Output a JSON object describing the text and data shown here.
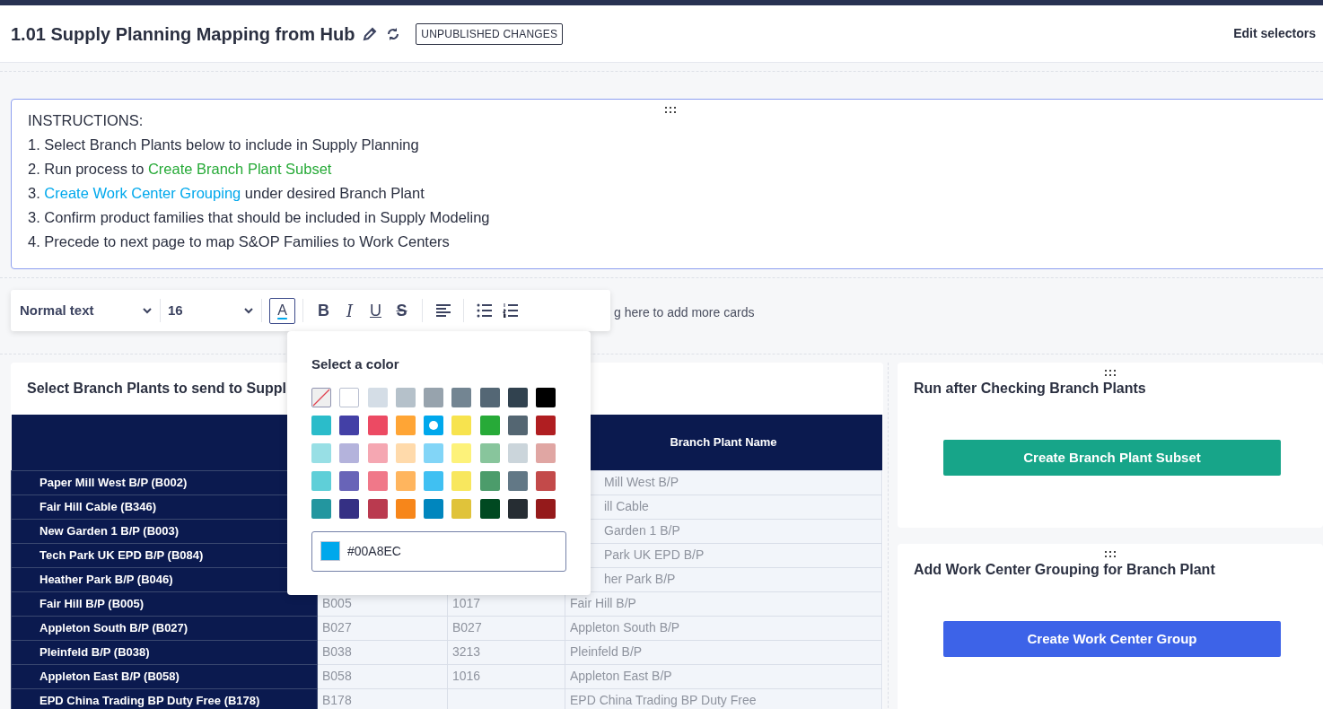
{
  "header": {
    "title": "1.01 Supply Planning Mapping from Hub",
    "badge": "UNPUBLISHED CHANGES",
    "action": "Edit selectors"
  },
  "instructions": {
    "lines": [
      [
        {
          "text": "INSTRUCTIONS:"
        }
      ],
      [
        {
          "text": "1. Select Branch Plants below to include in Supply Planning"
        }
      ],
      [
        {
          "text": "2. Run process to "
        },
        {
          "text": "Create Branch Plant Subset",
          "color": "#27aa38"
        }
      ],
      [
        {
          "text": "3. "
        },
        {
          "text": "Create Work Center Grouping",
          "color": "#00a8ec"
        },
        {
          "text": " under desired Branch Plant"
        }
      ],
      [
        {
          "text": "3. Confirm product families that should be included in Supply Modeling"
        }
      ],
      [
        {
          "text": "4. Precede to next page to map S&OP Families to Work Centers"
        }
      ]
    ]
  },
  "toolbar": {
    "style": "Normal text",
    "size": "16",
    "tools": [
      {
        "kind": "color",
        "label": "A",
        "selected": true
      },
      {
        "kind": "bold",
        "label": "B",
        "selected": false
      },
      {
        "kind": "italic",
        "label": "I",
        "selected": false
      },
      {
        "kind": "underline",
        "label": "U",
        "selected": false
      },
      {
        "kind": "strike",
        "label": "S",
        "selected": false
      },
      {
        "kind": "align",
        "selected": false
      },
      {
        "kind": "bullets",
        "selected": false
      },
      {
        "kind": "numbered",
        "selected": false
      }
    ]
  },
  "drop_hint": "g here to add more cards",
  "color_picker": {
    "title": "Select a color",
    "hex": "#00A8EC",
    "swatches": [
      {
        "kind": "none",
        "selected": false
      },
      {
        "color": "#ffffff",
        "selected": false
      },
      {
        "color": "#d4dde6",
        "selected": false
      },
      {
        "color": "#b5c1ca",
        "selected": false
      },
      {
        "color": "#97a3ad",
        "selected": false
      },
      {
        "color": "#738592",
        "selected": false
      },
      {
        "color": "#546775",
        "selected": false
      },
      {
        "color": "#31424f",
        "selected": false
      },
      {
        "color": "#000000",
        "selected": false
      },
      {
        "color": "#2bbcca",
        "selected": false
      },
      {
        "color": "#4340a6",
        "selected": false
      },
      {
        "color": "#ec4a63",
        "selected": false
      },
      {
        "color": "#ffa535",
        "selected": false
      },
      {
        "color": "#00a8ec",
        "selected": true
      },
      {
        "color": "#f7e34e",
        "selected": false
      },
      {
        "color": "#27aa38",
        "selected": false
      },
      {
        "color": "#546672",
        "selected": false
      },
      {
        "color": "#b01e21",
        "selected": false
      },
      {
        "color": "#98dfe5",
        "selected": false
      },
      {
        "color": "#b4b3dc",
        "selected": false
      },
      {
        "color": "#f5a7b2",
        "selected": false
      },
      {
        "color": "#ffdaab",
        "selected": false
      },
      {
        "color": "#82d5f7",
        "selected": false
      },
      {
        "color": "#fdf27a",
        "selected": false
      },
      {
        "color": "#88c59c",
        "selected": false
      },
      {
        "color": "#cbd5db",
        "selected": false
      },
      {
        "color": "#e0a6a3",
        "selected": false
      },
      {
        "color": "#5fcfd8",
        "selected": false
      },
      {
        "color": "#6864b8",
        "selected": false
      },
      {
        "color": "#f07889",
        "selected": false
      },
      {
        "color": "#ffb55e",
        "selected": false
      },
      {
        "color": "#40c0f2",
        "selected": false
      },
      {
        "color": "#f8e75e",
        "selected": false
      },
      {
        "color": "#4c9c6b",
        "selected": false
      },
      {
        "color": "#627886",
        "selected": false
      },
      {
        "color": "#c34a4a",
        "selected": false
      },
      {
        "color": "#23969f",
        "selected": false
      },
      {
        "color": "#353084",
        "selected": false
      },
      {
        "color": "#ba3a4f",
        "selected": false
      },
      {
        "color": "#f7861a",
        "selected": false
      },
      {
        "color": "#0086be",
        "selected": false
      },
      {
        "color": "#e0c33a",
        "selected": false
      },
      {
        "color": "#004921",
        "selected": false
      },
      {
        "color": "#262d33",
        "selected": false
      },
      {
        "color": "#951a1b",
        "selected": false
      }
    ]
  },
  "plants_card": {
    "title": "Select Branch Plants to send to Suppl",
    "table": {
      "columns": [
        "Branch Plant Name"
      ],
      "rows": [
        {
          "label": "Paper Mill West B/P (B002)",
          "name": "Mill West B/P"
        },
        {
          "label": "Fair Hill Cable (B346)",
          "name": "ill Cable"
        },
        {
          "label": "New Garden 1 B/P (B003)",
          "name": "Garden 1 B/P"
        },
        {
          "label": "Tech Park UK EPD B/P (B084)",
          "name": "Park UK EPD B/P"
        },
        {
          "label": "Heather Park B/P (B046)",
          "name": "her Park B/P"
        },
        {
          "label": "Fair Hill B/P (B005)",
          "code": "B005",
          "plant": "1017",
          "name": "Fair Hill B/P"
        },
        {
          "label": "Appleton South B/P (B027)",
          "code": "B027",
          "plant": "B027",
          "name": "Appleton South B/P"
        },
        {
          "label": "Pleinfeld B/P (B038)",
          "code": "B038",
          "plant": "3213",
          "name": "Pleinfeld B/P"
        },
        {
          "label": "Appleton East B/P (B058)",
          "code": "B058",
          "plant": "1016",
          "name": "Appleton East B/P"
        },
        {
          "label": "EPD China Trading BP Duty Free (B178)",
          "code": "B178",
          "name": "EPD China Trading BP Duty Free"
        }
      ]
    }
  },
  "action_cards": [
    {
      "title": "Run after Checking Branch Plants",
      "button": "Create Branch Plant Subset",
      "color": "#17a589"
    },
    {
      "title": "Add Work Center Grouping for Branch Plant",
      "button": "Create Work Center Group",
      "color": "#3d63e8"
    }
  ]
}
